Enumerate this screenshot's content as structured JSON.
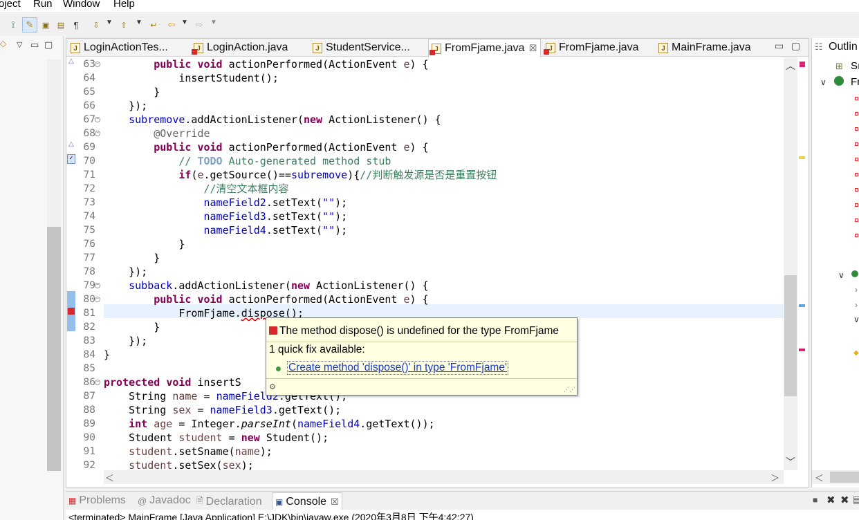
{
  "menu": {
    "items": [
      "oject",
      "Run",
      "Window",
      "Help"
    ]
  },
  "editor": {
    "tabs": [
      {
        "label": "LoginActionTes...",
        "active": false,
        "error": false
      },
      {
        "label": "LoginAction.java",
        "active": false,
        "error": true
      },
      {
        "label": "StudentService...",
        "active": false,
        "error": false
      },
      {
        "label": "FromFjame.java",
        "active": true,
        "error": true,
        "close": "☒"
      },
      {
        "label": "FromFjame.java",
        "active": false,
        "error": true
      },
      {
        "label": "MainFrame.java",
        "active": false,
        "error": false
      }
    ],
    "line_numbers": [
      "63",
      "64",
      "65",
      "66",
      "67",
      "68",
      "69",
      "70",
      "71",
      "72",
      "73",
      "74",
      "75",
      "76",
      "77",
      "78",
      "79",
      "80",
      "81",
      "82",
      "83",
      "84",
      "85",
      "86",
      "87",
      "88",
      "89",
      "90",
      "91",
      "92"
    ],
    "code_lines": [
      "        public void actionPerformed(ActionEvent e) {",
      "            insertStudent();",
      "        }",
      "    });",
      "    subremove.addActionListener(new ActionListener() {",
      "        @Override",
      "        public void actionPerformed(ActionEvent e) {",
      "            // TODO Auto-generated method stub",
      "            if(e.getSource()==subremove){//判断触发源是否是重置按钮",
      "                //清空文本框内容",
      "                nameField2.setText(\"\");",
      "                nameField3.setText(\"\");",
      "                nameField4.setText(\"\");",
      "            }",
      "        }",
      "    });",
      "    subback.addActionListener(new ActionListener() {",
      "        public void actionPerformed(ActionEvent e) {",
      "            FromFjame.dispose();",
      "        }",
      "    });",
      "}",
      "",
      "protected void insertS",
      "    String name = nameField2.getText();",
      "    String sex = nameField3.getText();",
      "    int age = Integer.parseInt(nameField4.getText());",
      "    Student student = new Student();",
      "    student.setSname(name);",
      "    student.setSex(sex);"
    ]
  },
  "hover": {
    "title": "The method dispose() is undefined for the type FromFjame",
    "quickfix_count": "1 quick fix available:",
    "fix_link": "Create method 'dispose()' in type 'FromFjame'"
  },
  "outline": {
    "title": "Outlin",
    "items": [
      "Sı",
      "Fr"
    ]
  },
  "bottom_tabs": [
    "Problems",
    "Javadoc",
    "Declaration",
    "Console"
  ],
  "console": {
    "status": "<terminated> MainFrame [Java Application] E:\\JDK\\bin\\javaw.exe (2020年3月8日 下午4:42:27)"
  },
  "colors": {
    "keyword": "#7f0055",
    "field": "#0000c0",
    "comment": "#3f7f5f",
    "string": "#2a00ff",
    "current_line": "#e8f2fe",
    "hover_bg": "#ffffe1",
    "error_mark": "#d8282c"
  }
}
